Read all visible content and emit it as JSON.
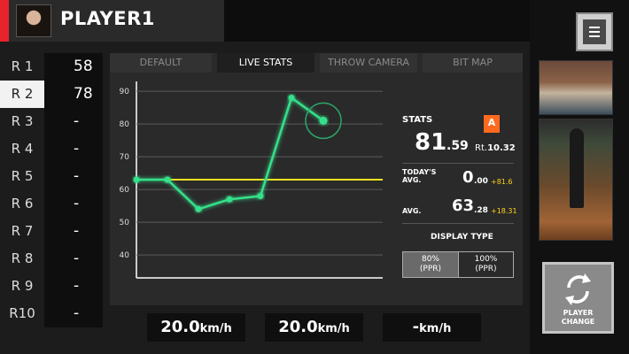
{
  "player": {
    "name": "PLAYER1"
  },
  "rounds": [
    {
      "label": "R 1",
      "score": "58"
    },
    {
      "label": "R 2",
      "score": "78"
    },
    {
      "label": "R 3",
      "score": "-"
    },
    {
      "label": "R 4",
      "score": "-"
    },
    {
      "label": "R 5",
      "score": "-"
    },
    {
      "label": "R 6",
      "score": "-"
    },
    {
      "label": "R 7",
      "score": "-"
    },
    {
      "label": "R 8",
      "score": "-"
    },
    {
      "label": "R 9",
      "score": "-"
    },
    {
      "label": "R10",
      "score": "-"
    }
  ],
  "active_round_index": 1,
  "tabs": [
    {
      "label": "DEFAULT",
      "active": false
    },
    {
      "label": "LIVE STATS",
      "active": true
    },
    {
      "label": "THROW CAMERA",
      "active": false
    },
    {
      "label": "BIT MAP",
      "active": false
    }
  ],
  "stats": {
    "title": "STATS",
    "rank_badge": "A",
    "value_int": "81",
    "value_dec": ".59",
    "rating_label": "Rt.",
    "rating_value": "10.32",
    "todays_avg_label_1": "TODAY'S",
    "todays_avg_label_2": "AVG.",
    "todays_avg_int": "0",
    "todays_avg_dec": ".00",
    "todays_avg_diff": "+81.6",
    "avg_label": "AVG.",
    "avg_int": "63",
    "avg_dec": ".28",
    "avg_diff": "+18.31",
    "display_type_label": "DISPLAY TYPE",
    "display_options": [
      {
        "line1": "80%",
        "line2": "(PPR)",
        "active": true
      },
      {
        "line1": "100%",
        "line2": "(PPR)",
        "active": false
      }
    ]
  },
  "speeds": [
    {
      "num": "20.0",
      "unit": "km/h"
    },
    {
      "num": "20.0",
      "unit": "km/h"
    },
    {
      "num": "-",
      "unit": "km/h"
    }
  ],
  "side": {
    "change_label_1": "PLAYER",
    "change_label_2": "CHANGE"
  },
  "colors": {
    "accent": "#e8232c",
    "line": "#35e08a",
    "avg_line": "#f0e020",
    "badge": "#ff6a1f",
    "diff": "#ffd21c"
  },
  "chart_data": {
    "type": "line",
    "yticks": [
      40,
      50,
      60,
      70,
      80,
      90
    ],
    "ylim": [
      33,
      93
    ],
    "x": [
      1,
      2,
      3,
      4,
      5,
      6,
      7
    ],
    "values": [
      63,
      63,
      54,
      57,
      58,
      88,
      81
    ],
    "reference_line": 63,
    "grid": true
  }
}
